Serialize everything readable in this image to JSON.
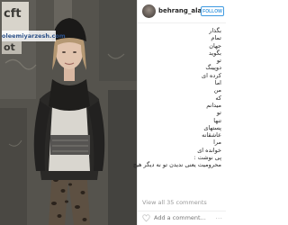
{
  "photo": {
    "watermark_text": "oleemiyarzesh.com",
    "sign_fragment": "cft",
    "sign_fragment2": "ot"
  },
  "header": {
    "username": "behrang_alavi",
    "follow_label": "FOLLOW"
  },
  "caption": {
    "lines": [
      "بگذار",
      "تمام",
      "جهان",
      "بگوید",
      "تو",
      "دوپینگ",
      "کرده ای",
      "اما",
      "من",
      "که",
      "میدانم",
      "تو",
      "تنها",
      "پستهای",
      "عاشقانه",
      "مرا",
      "خوانده ای",
      "پی نوشت :"
    ],
    "last_line": "محرومیت یعنی ندیدن تو نه دیگر هیچ"
  },
  "footer": {
    "view_comments": "View all 35 comments",
    "add_comment_placeholder": "Add a comment...",
    "more_label": "..."
  },
  "colors": {
    "accent": "#3f9ae0",
    "text": "#262626",
    "muted": "#999999"
  }
}
